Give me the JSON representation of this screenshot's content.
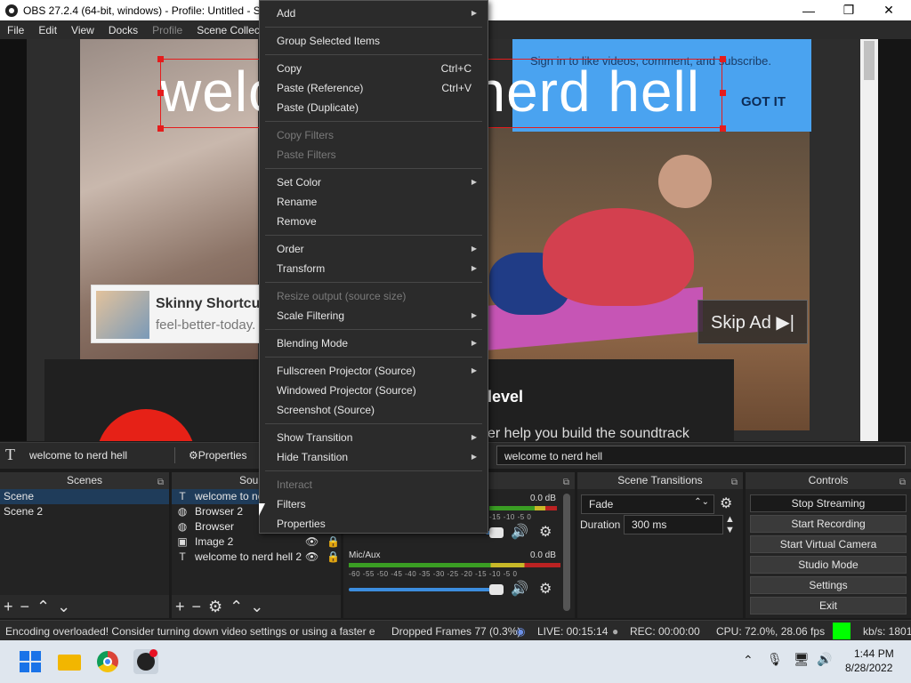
{
  "window": {
    "title": "OBS 27.2.4 (64-bit, windows) - Profile: Untitled - Sce",
    "minimize": "—",
    "maximize": "❐",
    "close": "✕"
  },
  "menubar": [
    "File",
    "Edit",
    "View",
    "Docks",
    "Profile",
    "Scene Collecti"
  ],
  "preview": {
    "overlay_text": "welcome to nerd hell",
    "signin_text": "Sign in to like videos, comment, and subscribe.",
    "signin_button": "GOT IT",
    "ad_title": "Skinny Shortcut",
    "ad_sub": "feel-better-today.",
    "skip_ad": "Skip Ad ▶|",
    "level_text": "level",
    "help_text": "er help you build the soundtrack"
  },
  "toolbar": {
    "selected_source": "welcome to nerd hell",
    "properties_label": "Properties",
    "text_field_value": "welcome to nerd hell"
  },
  "scenes": {
    "header": "Scenes",
    "items": [
      "Scene",
      "Scene 2"
    ]
  },
  "sources": {
    "header": "Source",
    "items": [
      {
        "label": "welcome to nerd",
        "icon": "T"
      },
      {
        "label": "Browser 2",
        "icon": "globe"
      },
      {
        "label": "Browser",
        "icon": "globe"
      },
      {
        "label": "Image 2",
        "icon": "image"
      },
      {
        "label": "welcome to nerd hell 2",
        "icon": "T"
      }
    ]
  },
  "mixer": {
    "ch1_level": "0.0 dB",
    "ch2_name": "Mic/Aux",
    "ch2_level": "0.0 dB",
    "scale": "-60 -55 -50 -45 -40 -35 -30 -25 -20 -15 -10 -5 0",
    "scale_short": "-15 -10 -5 0"
  },
  "transitions": {
    "header": "Scene Transitions",
    "selected": "Fade",
    "duration_label": "Duration",
    "duration_value": "300 ms"
  },
  "controls": {
    "header": "Controls",
    "buttons": [
      "Stop Streaming",
      "Start Recording",
      "Start Virtual Camera",
      "Studio Mode",
      "Settings",
      "Exit"
    ]
  },
  "status": {
    "message": "Encoding overloaded! Consider turning down video settings or using a faster e",
    "dropped": "Dropped Frames 77 (0.3%)",
    "live": "LIVE: 00:15:14",
    "rec": "REC: 00:00:00",
    "cpu": "CPU: 72.0%, 28.06 fps",
    "kbs": "kb/s: 1801",
    "stream_health_color": "#00ff00"
  },
  "taskbar": {
    "time": "1:44 PM",
    "date": "8/28/2022"
  },
  "context_menu": {
    "add": "Add",
    "group": "Group Selected Items",
    "copy": "Copy",
    "copy_shortcut": "Ctrl+C",
    "paste_ref": "Paste (Reference)",
    "paste_ref_shortcut": "Ctrl+V",
    "paste_dup": "Paste (Duplicate)",
    "copy_filters": "Copy Filters",
    "paste_filters": "Paste Filters",
    "set_color": "Set Color",
    "rename": "Rename",
    "remove": "Remove",
    "order": "Order",
    "transform": "Transform",
    "resize_output": "Resize output (source size)",
    "scale_filtering": "Scale Filtering",
    "blending_mode": "Blending Mode",
    "fullscreen_projector": "Fullscreen Projector (Source)",
    "windowed_projector": "Windowed Projector (Source)",
    "screenshot": "Screenshot (Source)",
    "show_transition": "Show Transition",
    "hide_transition": "Hide Transition",
    "interact": "Interact",
    "filters": "Filters",
    "properties": "Properties"
  }
}
